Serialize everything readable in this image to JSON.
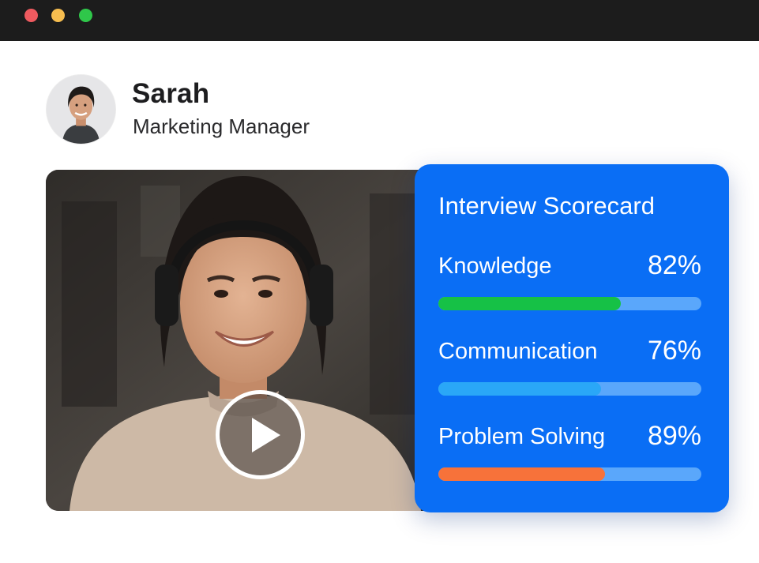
{
  "window": {
    "controls": [
      "close",
      "minimize",
      "maximize"
    ],
    "colors": {
      "close": "#ee5a5f",
      "minimize": "#f6bd4f",
      "maximize": "#2fc74a"
    }
  },
  "profile": {
    "name": "Sarah",
    "title": "Marketing Manager",
    "avatar_icon": "person-avatar"
  },
  "video": {
    "play_icon": "play-icon",
    "state": "paused"
  },
  "scorecard": {
    "title": "Interview Scorecard",
    "background": "#0a6ef5",
    "metrics": [
      {
        "label": "Knowledge",
        "value": "82%",
        "fraction": 0.695,
        "color": "#16c146"
      },
      {
        "label": "Communication",
        "value": "76%",
        "fraction": 0.62,
        "color": "#2aa7f7"
      },
      {
        "label": "Problem Solving",
        "value": "89%",
        "fraction": 0.635,
        "color": "#f7723a"
      }
    ],
    "track_color": "#5aa7fb"
  }
}
